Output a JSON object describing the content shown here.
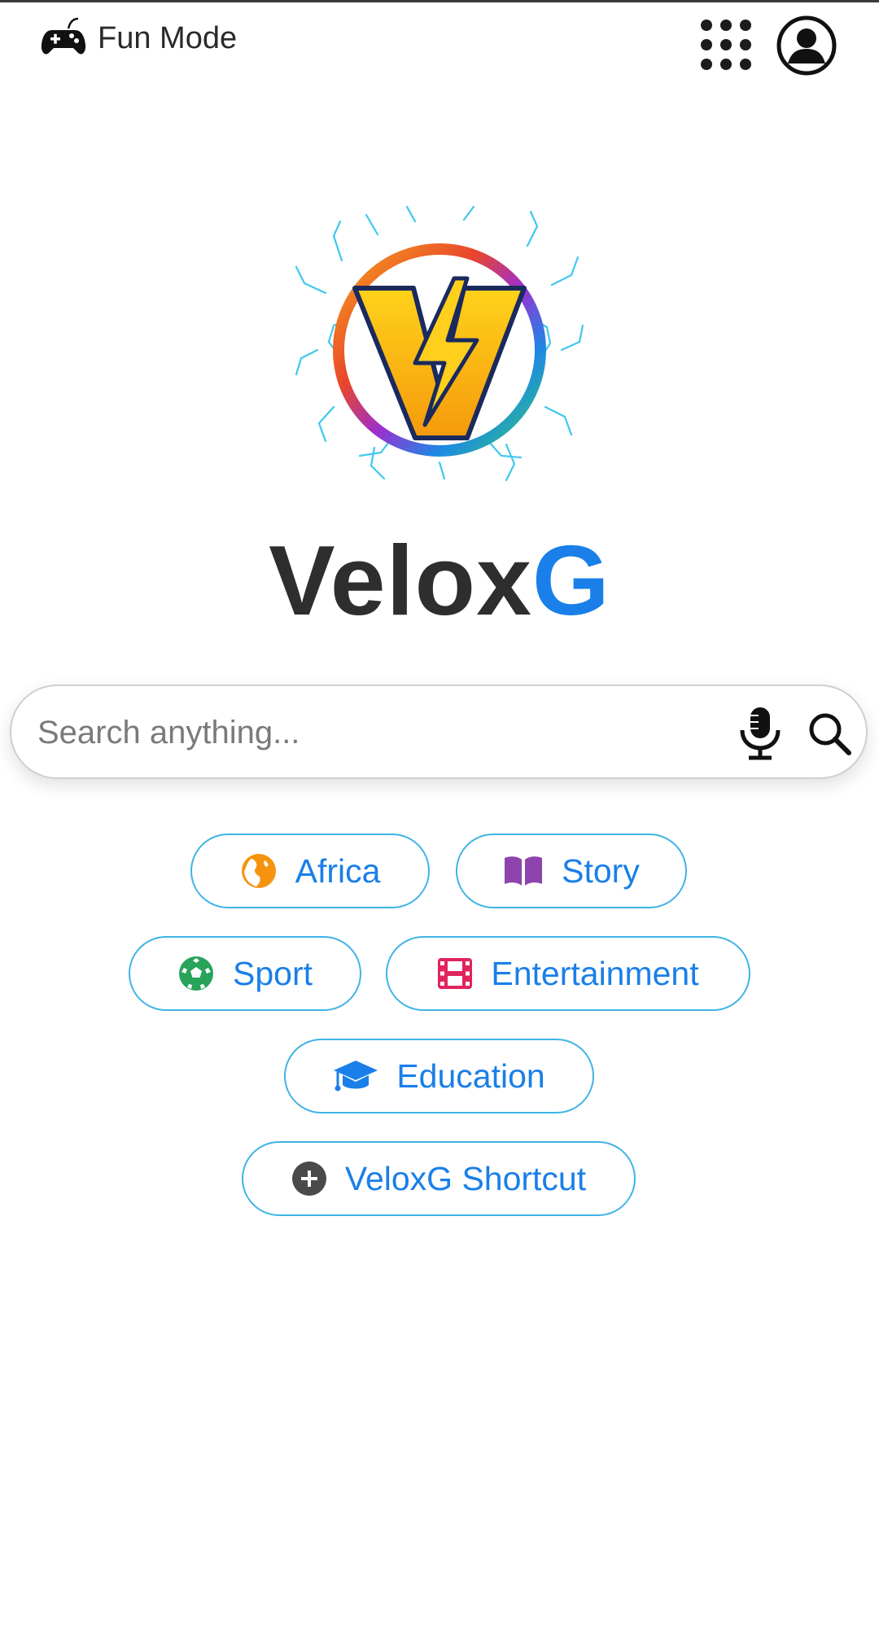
{
  "header": {
    "fun_mode_label": "Fun Mode",
    "icons": {
      "fun_mode": "gamepad-icon",
      "apps": "apps-grid-icon",
      "account": "account-circle-icon"
    }
  },
  "brand": {
    "part1": "Velox",
    "part2": "G",
    "colors": {
      "part1": "#2e2e2e",
      "part2": "#1a7fe8"
    }
  },
  "search": {
    "placeholder": "Search anything...",
    "value": "",
    "icons": {
      "voice": "microphone-icon",
      "submit": "search-icon"
    }
  },
  "chips": [
    {
      "label": "Africa",
      "icon": "globe-africa-icon",
      "icon_color": "#f5930f"
    },
    {
      "label": "Story",
      "icon": "book-open-icon",
      "icon_color": "#8e44ad"
    },
    {
      "label": "Sport",
      "icon": "soccer-ball-icon",
      "icon_color": "#27a35a"
    },
    {
      "label": "Entertainment",
      "icon": "film-icon",
      "icon_color": "#e0245e"
    },
    {
      "label": "Education",
      "icon": "graduation-cap-icon",
      "icon_color": "#1a7fe8"
    },
    {
      "label": "VeloxG Shortcut",
      "icon": "plus-circle-icon",
      "icon_color": "#4a4a4a"
    }
  ],
  "colors": {
    "chip_border": "#3fb3e6",
    "chip_text": "#1a7fe8"
  }
}
